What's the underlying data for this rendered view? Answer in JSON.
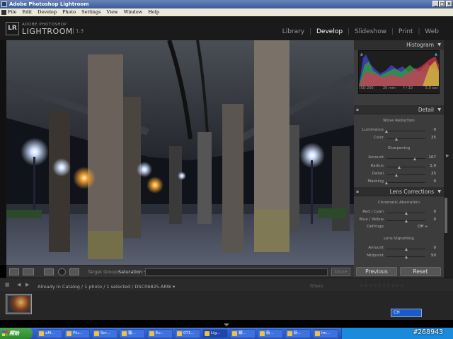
{
  "window": {
    "title": "Adobe Photoshop Lightroom",
    "controls": [
      "_",
      "□",
      "×"
    ]
  },
  "menu": [
    "File",
    "Edit",
    "Develop",
    "Photo",
    "Settings",
    "View",
    "Window",
    "Help"
  ],
  "identity_plate": {
    "badge": "LR",
    "line1": "ADOBE PHOTOSHOP",
    "line2": "LIGHTROOM",
    "version": "1.3"
  },
  "modules": [
    {
      "label": "Library",
      "active": false
    },
    {
      "label": "Develop",
      "active": true
    },
    {
      "label": "Slideshow",
      "active": false
    },
    {
      "label": "Print",
      "active": false
    },
    {
      "label": "Web",
      "active": false
    }
  ],
  "module_separator": "|",
  "histogram": {
    "title": "Histogram",
    "iso": "ISO 200",
    "focal": "20 mm",
    "aperture": "f / 10",
    "shutter": "5.0 sec"
  },
  "detail": {
    "title": "Detail",
    "noise_title": "Noise Reduction",
    "noise": [
      {
        "label": "Luminance",
        "value": "0",
        "pos": 0.0
      },
      {
        "label": "Color",
        "value": "25",
        "pos": 0.25
      }
    ],
    "sharpen_title": "Sharpening",
    "sharpen": [
      {
        "label": "Amount",
        "value": "107",
        "pos": 0.72
      },
      {
        "label": "Radius",
        "value": "1.0",
        "pos": 0.33
      },
      {
        "label": "Detail",
        "value": "25",
        "pos": 0.25
      },
      {
        "label": "Masking",
        "value": "0",
        "pos": 0.0
      }
    ]
  },
  "lens": {
    "title": "Lens Corrections",
    "ca_title": "Chromatic Aberration",
    "ca": [
      {
        "label": "Red / Cyan",
        "value": "0",
        "pos": 0.5
      },
      {
        "label": "Blue / Yellow",
        "value": "0",
        "pos": 0.5
      }
    ],
    "defringe_label": "Defringe",
    "defringe_value": "Off ÷",
    "vig_title": "Lens Vignetting",
    "vig": [
      {
        "label": "Amount",
        "value": "0",
        "pos": 0.5
      },
      {
        "label": "Midpoint",
        "value": "50",
        "pos": 0.5
      }
    ]
  },
  "buttons": {
    "previous": "Previous",
    "reset": "Reset",
    "done": "Done"
  },
  "toolbar": {
    "target_group_label": "Target Group:",
    "target_group_value": "Saturation ÷"
  },
  "filmstrip": {
    "breadcrumb": "Already In Catalog / 1 photo / 1 selected / DSC06825.ARW ▾",
    "filters_label": "Filters:",
    "stars": "☆☆☆☆☆☆☆☆☆☆"
  },
  "ime": {
    "label": "CH"
  },
  "taskbar": {
    "start": "開始",
    "tasks": [
      "aM...",
      "Plu...",
      "Scr...",
      "報...",
      "Ev...",
      "071...",
      "Lig...",
      "網...",
      "新...",
      "新...",
      "Im..."
    ],
    "active_index": 6
  },
  "watermark": "#268943",
  "colors": {
    "accent": "#ffffff",
    "panel": "#3c3c3c",
    "header": "#2e2e2e"
  }
}
